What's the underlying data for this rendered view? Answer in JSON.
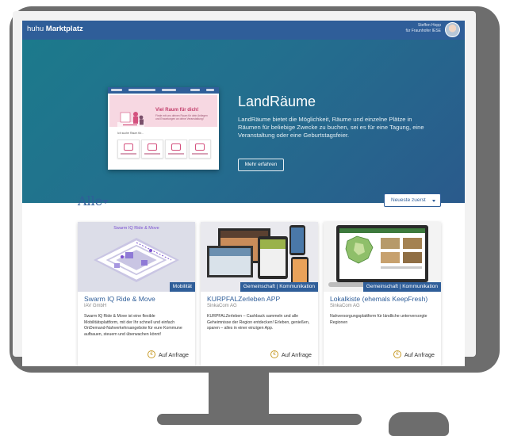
{
  "app": {
    "brand_prefix": "huhu",
    "brand_name": "Marktplatz",
    "user_name": "Steffen Hopp",
    "user_org": "für Fraunhofer IESE"
  },
  "hero": {
    "title": "LandRäume",
    "text": "LandRäume bietet die Möglichkeit, Räume und einzelne Plätze in Räumen für beliebige Zwecke zu buchen, sei es für eine Tagung, eine Veranstaltung oder eine Geburtstagsfeier.",
    "button_label": "Mehr erfahren",
    "preview": {
      "headline": "Viel Raum für dich!",
      "subline": "Finde mit uns deinen Raum für dein Anliegen und Erwartungen an deine Veranstaltung!",
      "search_label": "Ich suche Raum für..."
    }
  },
  "listing": {
    "filter_label": "Alle",
    "sort_label": "Neueste zuerst"
  },
  "cards": [
    {
      "image_title": "Swarm IQ Ride & Move",
      "tag": "Mobilität",
      "title": "Swarm IQ Ride & Move",
      "org": "IAV GmbH",
      "description": "Swarm IQ Ride & Move ist eine flexible Mobilitätsplattform, mit der Ihr schnell und einfach OnDemand-Nahverkehrsangebote für eure Kommune aufbauen, steuern und überwachen könnt!",
      "cta": "Auf Anfrage"
    },
    {
      "tag": "Gemeinschaft | Kommunikation",
      "title": "KURPFALZerleben APP",
      "org": "SinkaCom AG",
      "description": "KURPFALZerleben – Cashback sammeln und alle Geheimnisse der Region entdecken! Erleben, genießen, sparen – alles in einer einzigen App.",
      "cta": "Auf Anfrage"
    },
    {
      "tag": "Gemeinschaft | Kommunikation",
      "title": "Lokalkiste (ehemals KeepFresh)",
      "org": "SinkaCom AG",
      "description": "Nahversorgungsplattform für ländliche unterversorgte Regionen",
      "cta": "Auf Anfrage"
    }
  ],
  "icons": {
    "cta": "euro-circle-icon",
    "filter": "caret-down-icon",
    "sort": "chevron-down-icon"
  },
  "colors": {
    "brand_blue": "#2f5e99",
    "hero_teal": "#1c7a8c",
    "cta_gold": "#c89c2a",
    "preview_pink": "#d4517e"
  }
}
